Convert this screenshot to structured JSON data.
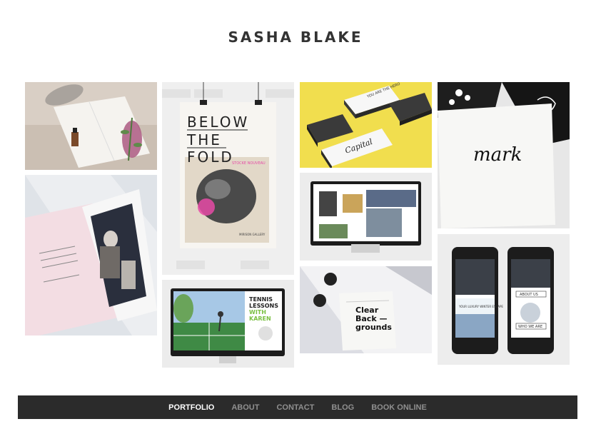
{
  "site": {
    "title": "SASHA BLAKE"
  },
  "nav": {
    "items": [
      {
        "label": "PORTFOLIO",
        "active": true
      },
      {
        "label": "ABOUT",
        "active": false
      },
      {
        "label": "CONTACT",
        "active": false
      },
      {
        "label": "BLOG",
        "active": false
      },
      {
        "label": "BOOK ONLINE",
        "active": false
      }
    ]
  },
  "gallery": {
    "poster": {
      "line1": "BELOW",
      "line2": "THE",
      "line3": "FOLD",
      "subtitle": "STOCKE NOUVEAU",
      "gallery_name": "MIRISON GALLERY"
    },
    "cards": {
      "brand": "Capital",
      "slogan": "YOU ARE THE HERO"
    },
    "signature": {
      "text": "mark"
    },
    "tennis": {
      "title_line1": "TENNIS",
      "title_line2": "LESSONS",
      "accent1": "WITH",
      "accent2": "KAREN"
    },
    "cd": {
      "line1": "Clear",
      "line2": "Back —",
      "line3": "grounds"
    },
    "phones": {
      "about": "ABOUT US",
      "who": "WHO WE ARE",
      "banner": "YOUR LUXURY WINTER ESCAPE"
    }
  },
  "colors": {
    "nav_bg": "#2b2b2b",
    "nav_active": "#ffffff",
    "nav_inactive": "#8f8f8f",
    "accent_yellow": "#f1de4e",
    "accent_green": "#7bc043",
    "accent_pink": "#e64aa6"
  }
}
